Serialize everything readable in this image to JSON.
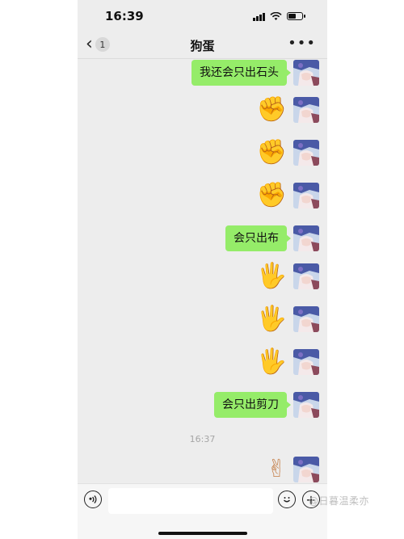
{
  "status_bar": {
    "time": "16:39"
  },
  "nav": {
    "back_badge": "1",
    "title": "狗蛋",
    "more": "•••"
  },
  "messages": [
    {
      "type": "text",
      "text": "我还会只出石头"
    },
    {
      "type": "emoji",
      "emoji": "fist",
      "glyph": "✊"
    },
    {
      "type": "emoji",
      "emoji": "fist",
      "glyph": "✊"
    },
    {
      "type": "emoji",
      "emoji": "fist",
      "glyph": "✊"
    },
    {
      "type": "text",
      "text": "会只出布"
    },
    {
      "type": "emoji",
      "emoji": "open-hand",
      "glyph": "🖐"
    },
    {
      "type": "emoji",
      "emoji": "open-hand",
      "glyph": "🖐"
    },
    {
      "type": "emoji",
      "emoji": "open-hand",
      "glyph": "🖐"
    },
    {
      "type": "text",
      "text": "会只出剪刀"
    },
    {
      "type": "timestamp",
      "text": "16:37"
    },
    {
      "type": "emoji",
      "emoji": "victory-hand",
      "glyph": "✌"
    }
  ],
  "input_bar": {
    "voice_icon": "voice-icon",
    "emoji_icon": "smiley-icon",
    "plus_icon": "plus-icon"
  },
  "watermark": "@日暮温柔亦"
}
